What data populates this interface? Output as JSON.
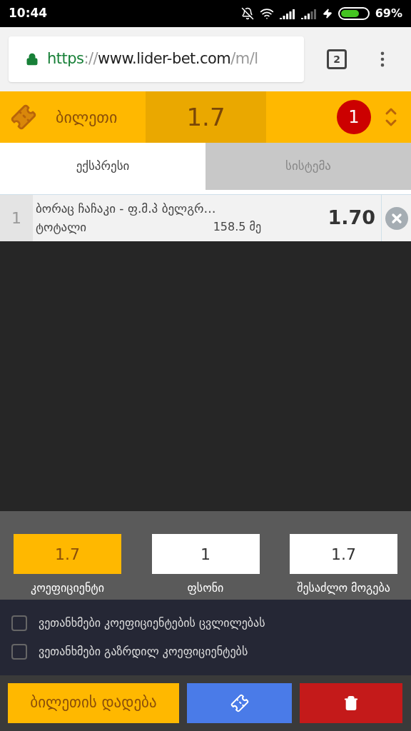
{
  "status_bar": {
    "time": "10:44",
    "battery": "69%"
  },
  "browser": {
    "url_scheme": "https",
    "url_sep": "://",
    "url_host": "www.lider-bet.com",
    "url_path": "/m/l",
    "tab_count": "2"
  },
  "header": {
    "title": "ბილეთი",
    "odds": "1.7",
    "count": "1"
  },
  "tabs": [
    {
      "label": "ექსპრესი",
      "selected": true
    },
    {
      "label": "სისტემა",
      "selected": false
    }
  ],
  "bets": [
    {
      "index": "1",
      "match": "ბორაც ჩაჩაკი - ფ.მ.პ ბელგრ…",
      "market": "ტოტალი",
      "selection": "158.5 მე",
      "odds": "1.70"
    }
  ],
  "summary": [
    {
      "label": "კოეფიციენტი",
      "value": "1.7",
      "kind": "highlight"
    },
    {
      "label": "ფსონი",
      "value": "1",
      "kind": "input"
    },
    {
      "label": "შესაძლო მოგება",
      "value": "1.7",
      "kind": "input"
    }
  ],
  "options": [
    {
      "label": "ვეთანხმები კოეფიციენტების ცვლილებას",
      "checked": false
    },
    {
      "label": "ვეთანხმები გაზრდილ კოეფიციენტებს",
      "checked": false
    }
  ],
  "actions": {
    "place_bet": "ბილეთის დადება"
  }
}
